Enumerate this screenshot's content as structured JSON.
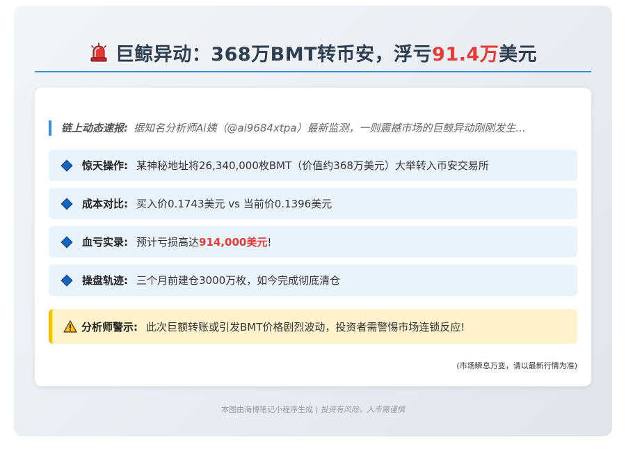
{
  "header": {
    "title_prefix": "巨鲸异动：368万BMT转币安，浮亏",
    "title_accent": "91.4万",
    "title_suffix": "美元",
    "icon": "siren-icon",
    "accent_color": "#e53935",
    "rule_color": "#3a8ed8"
  },
  "intro": {
    "lead": "链上动态速报:",
    "text": "据知名分析师Ai姨（@ai9684xtpa）最新监测，一则震撼市场的巨鲸异动刚刚发生..."
  },
  "items": [
    {
      "label": "惊天操作:",
      "text": "某神秘地址将26,340,000枚BMT（价值约368万美元）大举转入币安交易所",
      "highlight": "",
      "text_after": ""
    },
    {
      "label": "成本对比:",
      "text": "买入价0.1743美元 vs 当前价0.1396美元",
      "highlight": "",
      "text_after": ""
    },
    {
      "label": "血亏实录:",
      "text": "预计亏损高达",
      "highlight": "914,000美元",
      "text_after": "!"
    },
    {
      "label": "操盘轨迹:",
      "text": "三个月前建仓3000万枚，如今完成彻底清仓",
      "highlight": "",
      "text_after": ""
    }
  ],
  "warning": {
    "icon": "warning-icon",
    "label": "分析师警示:",
    "text": "此次巨额转账或引发BMT价格剧烈波动，投资者需警惕市场连锁反应!"
  },
  "note": "(市场瞬息万变，请以最新行情为准)",
  "footer": {
    "source": "本图由海博笔记小程序生成 |",
    "disclaimer": "投资有风险，入市需谨慎"
  }
}
